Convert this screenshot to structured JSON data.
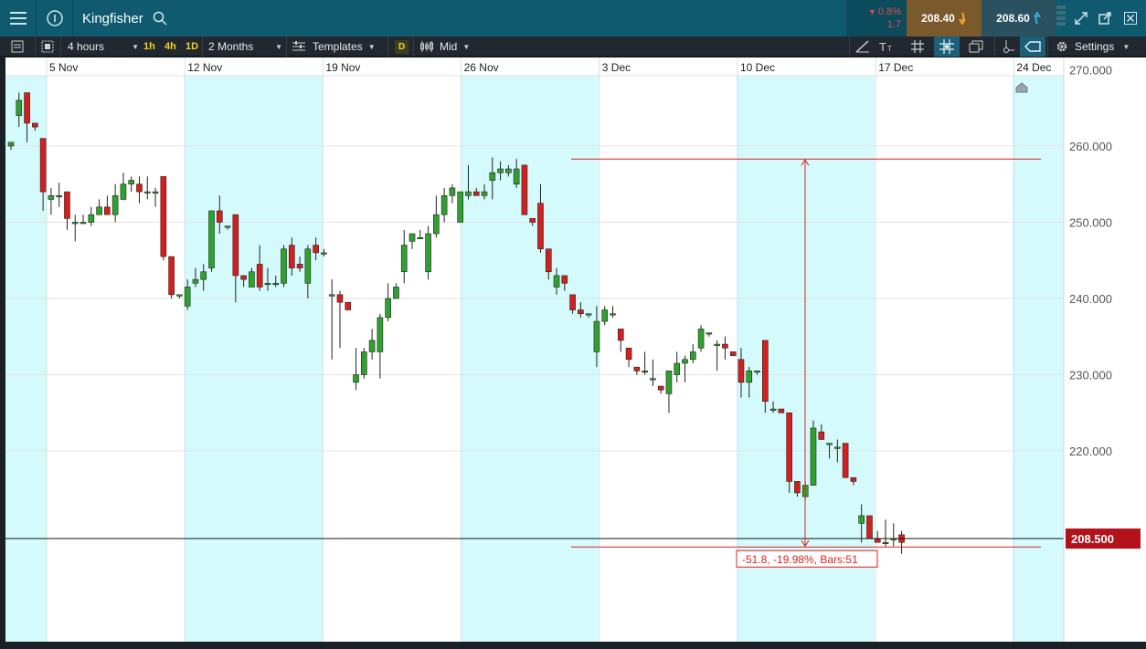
{
  "header": {
    "title": "Kingfisher",
    "change_pct": "0.8%",
    "change_abs": "1.7",
    "sell_price": "208.40",
    "buy_price": "208.60",
    "icons": [
      "menu-icon",
      "info-icon",
      "search-icon",
      "arrow-down-icon",
      "arrow-up-icon",
      "expand-icon",
      "popout-icon",
      "close-icon"
    ]
  },
  "toolbar": {
    "interval": "4 hours",
    "quick_intervals": [
      "1h",
      "4h",
      "1D"
    ],
    "period": "2 Months",
    "templates_label": "Templates",
    "d_label": "D",
    "price_type": "Mid",
    "settings_label": "Settings",
    "icons": [
      "layout-icon",
      "chart-type-icon",
      "templates-icon",
      "candles-icon",
      "line-draw-icon",
      "text-icon",
      "grid-icon",
      "crosshair-icon",
      "clone-icon",
      "pointer-icon",
      "label-icon",
      "gear-icon"
    ]
  },
  "chart_data": {
    "type": "candlestick",
    "date_labels": [
      "5 Nov",
      "12 Nov",
      "19 Nov",
      "26 Nov",
      "3 Dec",
      "10 Dec",
      "17 Dec",
      "24 Dec"
    ],
    "y_ticks": [
      "270.000",
      "260.000",
      "250.000",
      "240.000",
      "230.000",
      "220.000"
    ],
    "ylim": [
      196,
      271
    ],
    "current_price": "208.500",
    "measure_label": "-51.8, -19.98%, Bars:51",
    "measure_high": 258.3,
    "measure_low": 207.4,
    "candles": [
      [
        260,
        260.5,
        259.5,
        260.5
      ],
      [
        264,
        267,
        262.5,
        266
      ],
      [
        267,
        267,
        260.5,
        263
      ],
      [
        263,
        263,
        262,
        262.5
      ],
      [
        261,
        261,
        251.5,
        254
      ],
      [
        253,
        254.5,
        251,
        253.5
      ],
      [
        253.5,
        255.2,
        252,
        253.5
      ],
      [
        254,
        254,
        249,
        250.5
      ],
      [
        250,
        251,
        247.5,
        250
      ],
      [
        250,
        251,
        250,
        250
      ],
      [
        250,
        252,
        249.5,
        251
      ],
      [
        251,
        253,
        251,
        252
      ],
      [
        252,
        253.5,
        251,
        251
      ],
      [
        251,
        255,
        250,
        253.5
      ],
      [
        253,
        256.5,
        253,
        255
      ],
      [
        255,
        256,
        254,
        255.5
      ],
      [
        255,
        256,
        252.5,
        254
      ],
      [
        254,
        256,
        253,
        254
      ],
      [
        254,
        254.5,
        252,
        254
      ],
      [
        256,
        256,
        245,
        245.5
      ],
      [
        245.5,
        245.5,
        240,
        240.5
      ],
      [
        240.5,
        240.5,
        240,
        240.5
      ],
      [
        239,
        242.5,
        238.5,
        241.5
      ],
      [
        242,
        244,
        241.5,
        242.5
      ],
      [
        242.5,
        244.5,
        241,
        243.5
      ],
      [
        244,
        251.5,
        243.5,
        251.5
      ],
      [
        251.5,
        253.5,
        248.5,
        250
      ],
      [
        249.5,
        249.5,
        249,
        249.5
      ],
      [
        251,
        251,
        239.5,
        243
      ],
      [
        243,
        243,
        241.5,
        242.5
      ],
      [
        241.5,
        244,
        241.5,
        243.5
      ],
      [
        244.5,
        247,
        241,
        241.5
      ],
      [
        242,
        244,
        241,
        242
      ],
      [
        242,
        243,
        241.5,
        242
      ],
      [
        242,
        247,
        241.5,
        246.5
      ],
      [
        247,
        248,
        243,
        244
      ],
      [
        244.5,
        245.5,
        243.5,
        244
      ],
      [
        242,
        247,
        240,
        246.5
      ],
      [
        247,
        248,
        245,
        246
      ],
      [
        246,
        246.5,
        245.5,
        246
      ],
      [
        240.5,
        242.5,
        232,
        240.5
      ],
      [
        240.5,
        241,
        233.5,
        239.5
      ],
      [
        239.5,
        239.5,
        238.5,
        238.5
      ],
      [
        229,
        233.5,
        228,
        230
      ],
      [
        230,
        233.5,
        229.5,
        233
      ],
      [
        233,
        236,
        232,
        234.5
      ],
      [
        233,
        238,
        229.5,
        237.5
      ],
      [
        237.5,
        242,
        237,
        240
      ],
      [
        240,
        242,
        240,
        241.5
      ],
      [
        243.5,
        249,
        242,
        247
      ],
      [
        247.5,
        248.5,
        246.5,
        248.5
      ],
      [
        248,
        249,
        248,
        248
      ],
      [
        243.5,
        249.5,
        242.5,
        248.5
      ],
      [
        248.5,
        253.5,
        248,
        251
      ],
      [
        251,
        254.5,
        250,
        253.5
      ],
      [
        253.5,
        255,
        252.5,
        254.5
      ],
      [
        250,
        253,
        250,
        254
      ],
      [
        253.5,
        257.5,
        253,
        254
      ],
      [
        254,
        254.5,
        253.5,
        253.5
      ],
      [
        253.5,
        255,
        253,
        254
      ],
      [
        255.5,
        258.5,
        253,
        256.5
      ],
      [
        256.5,
        258,
        255.5,
        257
      ],
      [
        256.5,
        257.5,
        256,
        257
      ],
      [
        255,
        258.3,
        254.5,
        257
      ],
      [
        257.5,
        257.5,
        251,
        251
      ],
      [
        250.5,
        250.5,
        249.5,
        250
      ],
      [
        252.5,
        255,
        246,
        246.5
      ],
      [
        246.5,
        246.5,
        242.5,
        243.5
      ],
      [
        241.5,
        244,
        240.5,
        243
      ],
      [
        243,
        243,
        241,
        242
      ],
      [
        240.5,
        240.5,
        238,
        238.5
      ],
      [
        238.5,
        239.5,
        237.5,
        238
      ],
      [
        238,
        238,
        237.5,
        238
      ],
      [
        233,
        239,
        231,
        237
      ],
      [
        237,
        239,
        236.5,
        238.5
      ],
      [
        238,
        239,
        237.5,
        238
      ],
      [
        236,
        236,
        233,
        234.5
      ],
      [
        233.5,
        233.5,
        231,
        232
      ],
      [
        231,
        231,
        230,
        230.5
      ],
      [
        230.5,
        233,
        230,
        230.5
      ],
      [
        229.5,
        232,
        228.5,
        229.5
      ],
      [
        228.5,
        228.5,
        227.5,
        228
      ],
      [
        227.5,
        230.5,
        225,
        230.5
      ],
      [
        230,
        233,
        229,
        231.5
      ],
      [
        231.5,
        232.5,
        229,
        232
      ],
      [
        232,
        234,
        231.5,
        233
      ],
      [
        233.5,
        236.5,
        233,
        236
      ],
      [
        235.5,
        235.5,
        235,
        235.5
      ],
      [
        234,
        234.5,
        230.5,
        234
      ],
      [
        234,
        235,
        232,
        233.5
      ],
      [
        233,
        233,
        232.5,
        232.5
      ],
      [
        232,
        233.5,
        227,
        229
      ],
      [
        229,
        231,
        227,
        230.5
      ],
      [
        230.5,
        230.5,
        230,
        230.5
      ],
      [
        234.5,
        234.5,
        225,
        226.5
      ],
      [
        225.5,
        226.5,
        225,
        225.5
      ],
      [
        225.5,
        225.5,
        225,
        225
      ],
      [
        225,
        225,
        214.5,
        216
      ],
      [
        216,
        216,
        214,
        214.5
      ],
      [
        214,
        216,
        213.5,
        215.5
      ],
      [
        215.5,
        224,
        215.5,
        223
      ],
      [
        222.5,
        223.5,
        221.5,
        221.5
      ],
      [
        221,
        221,
        219,
        221
      ],
      [
        220.5,
        221.5,
        218.5,
        220.5
      ],
      [
        221,
        221,
        216.5,
        216.5
      ],
      [
        216.5,
        216.5,
        215.5,
        216
      ],
      [
        210.5,
        213,
        208,
        211.5
      ],
      [
        211.5,
        211.5,
        208.5,
        208.5
      ],
      [
        208.5,
        209.5,
        208,
        208
      ],
      [
        208,
        211,
        207.5,
        208
      ],
      [
        208.5,
        210.5,
        207.5,
        208.5
      ],
      [
        209,
        209.5,
        206.5,
        208
      ]
    ]
  }
}
